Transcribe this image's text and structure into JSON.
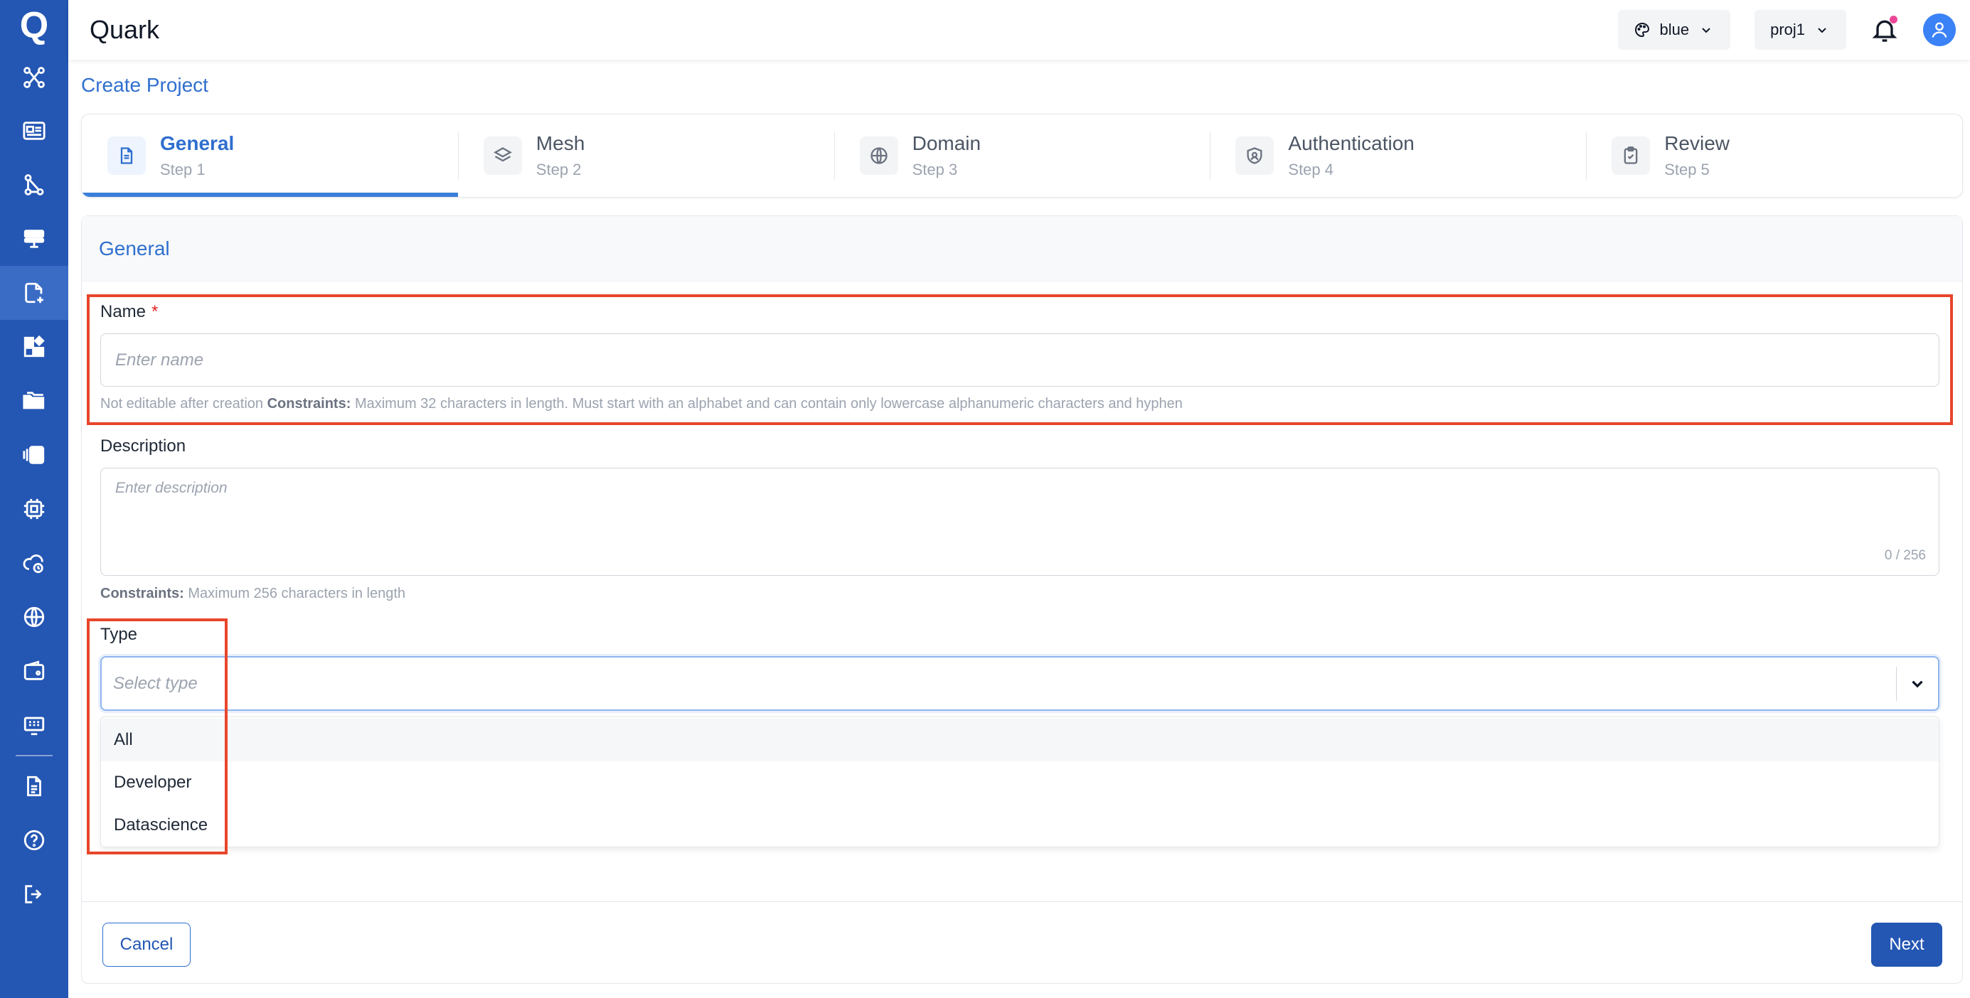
{
  "app": {
    "title": "Quark",
    "logo": "Q"
  },
  "header": {
    "theme_select": {
      "value": "blue",
      "icon": "palette-icon"
    },
    "project_select": {
      "value": "proj1"
    },
    "notifications_icon": "bell-icon",
    "user_icon": "user-icon"
  },
  "sidebar": {
    "items": [
      {
        "name": "topology",
        "icon": "share-nodes-icon"
      },
      {
        "name": "dashboard",
        "icon": "id-card-icon"
      },
      {
        "name": "routes",
        "icon": "path-nodes-icon"
      },
      {
        "name": "services",
        "icon": "server-icon"
      },
      {
        "name": "create-project",
        "icon": "file-plus-icon",
        "active": true
      },
      {
        "name": "widgets",
        "icon": "widgets-icon"
      },
      {
        "name": "projects",
        "icon": "folders-icon"
      },
      {
        "name": "registry",
        "icon": "cards-icon"
      },
      {
        "name": "hardware",
        "icon": "chip-icon"
      },
      {
        "name": "cloud",
        "icon": "cloud-sync-icon"
      },
      {
        "name": "domains",
        "icon": "globe-icon"
      },
      {
        "name": "wallet",
        "icon": "wallet-icon"
      },
      {
        "name": "devices",
        "icon": "monitor-icon"
      },
      {
        "name": "docs",
        "icon": "document-icon"
      },
      {
        "name": "help",
        "icon": "help-circle-icon"
      },
      {
        "name": "logout",
        "icon": "logout-icon"
      }
    ]
  },
  "page": {
    "title": "Create Project"
  },
  "stepper": {
    "steps": [
      {
        "title": "General",
        "sub": "Step 1",
        "icon": "document-icon",
        "active": true
      },
      {
        "title": "Mesh",
        "sub": "Step 2",
        "icon": "layers-icon"
      },
      {
        "title": "Domain",
        "sub": "Step 3",
        "icon": "globe-icon"
      },
      {
        "title": "Authentication",
        "sub": "Step 4",
        "icon": "shield-icon"
      },
      {
        "title": "Review",
        "sub": "Step 5",
        "icon": "clipboard-check-icon"
      }
    ]
  },
  "form": {
    "section_title": "General",
    "name": {
      "label": "Name",
      "required_mark": "*",
      "placeholder": "Enter name",
      "hint_prefix": "Not editable after creation",
      "hint_constraints_label": "Constraints:",
      "hint_constraints": "Maximum 32 characters in length. Must start with an alphabet and can contain only lowercase alphanumeric characters and hyphen"
    },
    "description": {
      "label": "Description",
      "placeholder": "Enter description",
      "counter": "0 / 256",
      "hint_constraints_label": "Constraints:",
      "hint_constraints": "Maximum 256 characters in length"
    },
    "type": {
      "label": "Type",
      "placeholder": "Select type",
      "options": [
        "All",
        "Developer",
        "Datascience"
      ]
    }
  },
  "actions": {
    "cancel": "Cancel",
    "next": "Next"
  },
  "colors": {
    "brand": "#2456b3",
    "accent": "#2f6fce",
    "highlight": "#e8462b"
  }
}
